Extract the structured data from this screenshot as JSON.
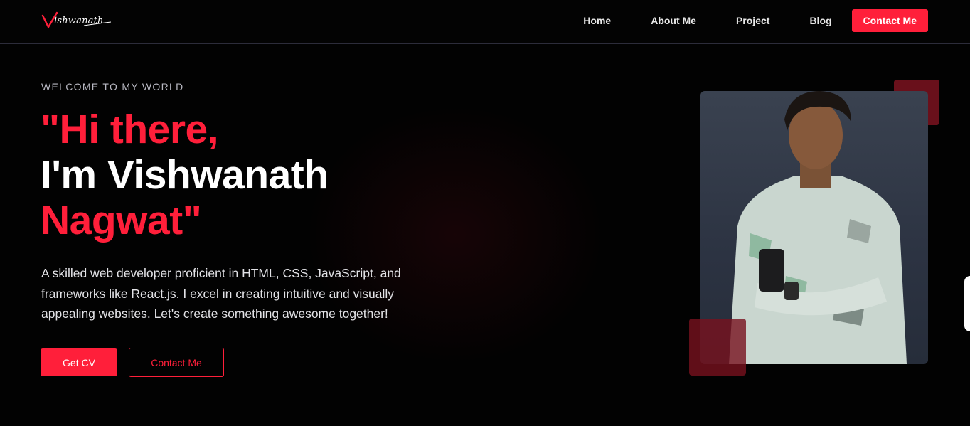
{
  "nav": {
    "logo_initial": "V",
    "logo_rest": "ishwanath",
    "links": [
      "Home",
      "About Me",
      "Project",
      "Blog"
    ],
    "cta": "Contact Me"
  },
  "hero": {
    "eyebrow": "WELCOME TO MY WORLD",
    "line1": "\"Hi there,",
    "line2": "I'm Vishwanath",
    "line3": "Nagwat\"",
    "bio": "A skilled web developer proficient in HTML, CSS, JavaScript, and frameworks like React.js. I excel in creating intuitive and visually appealing websites. Let's create something awesome together!",
    "btn_cv": "Get CV",
    "btn_contact": "Contact Me"
  },
  "colors": {
    "accent": "#ff1f3a",
    "background": "#020202",
    "card": "#2c3342"
  }
}
